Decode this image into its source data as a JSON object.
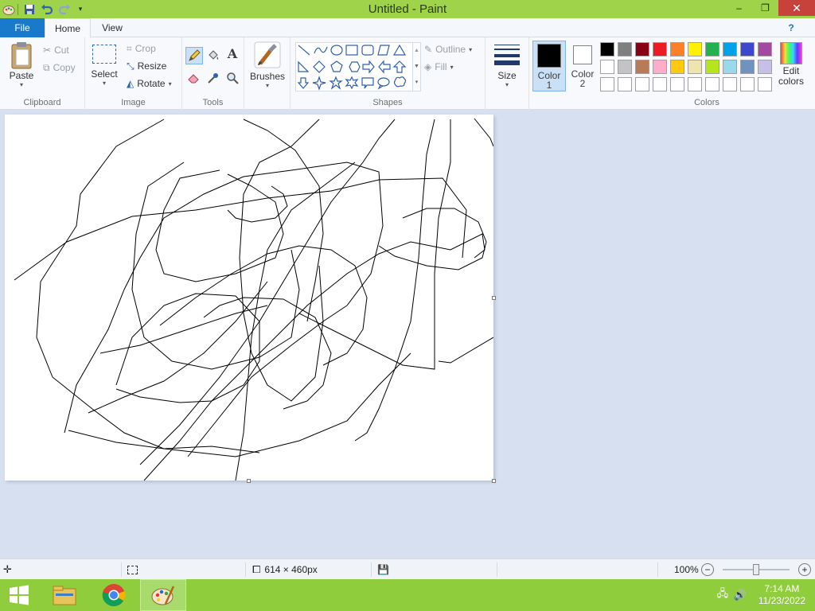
{
  "window": {
    "title": "Untitled - Paint",
    "minimize": "–",
    "restore": "❐",
    "close": "✕"
  },
  "tabs": {
    "file": "File",
    "home": "Home",
    "view": "View",
    "help": "?"
  },
  "ribbon": {
    "clipboard": {
      "label": "Clipboard",
      "paste": "Paste",
      "cut": "Cut",
      "copy": "Copy"
    },
    "image": {
      "label": "Image",
      "select": "Select",
      "crop": "Crop",
      "resize": "Resize",
      "rotate": "Rotate"
    },
    "tools": {
      "label": "Tools"
    },
    "brushes": {
      "label": "Brushes"
    },
    "shapes": {
      "label": "Shapes",
      "outline": "Outline",
      "fill": "Fill"
    },
    "size": {
      "label": "Size"
    },
    "color1": {
      "label1": "Color",
      "label2": "1",
      "value": "#000000"
    },
    "color2": {
      "label1": "Color",
      "label2": "2",
      "value": "#ffffff"
    },
    "colors": {
      "label": "Colors",
      "edit1": "Edit",
      "edit2": "colors",
      "row1": [
        "#000000",
        "#7f7f7f",
        "#880015",
        "#ed1c24",
        "#ff7f27",
        "#fff200",
        "#22b14c",
        "#00a2e8",
        "#3f48cc",
        "#a349a4"
      ],
      "row2": [
        "#ffffff",
        "#c3c3c3",
        "#b97a57",
        "#ffaec9",
        "#ffc90e",
        "#efe4b0",
        "#b5e61d",
        "#99d9ea",
        "#7092be",
        "#c8bfe7"
      ],
      "row3": [
        "#ffffff",
        "#ffffff",
        "#ffffff",
        "#ffffff",
        "#ffffff",
        "#ffffff",
        "#ffffff",
        "#ffffff",
        "#ffffff",
        "#ffffff"
      ]
    }
  },
  "status": {
    "canvas_size": "614 × 460px",
    "zoom": "100%"
  },
  "taskbar": {
    "time": "7:14 AM",
    "date": "11/23/2022"
  }
}
